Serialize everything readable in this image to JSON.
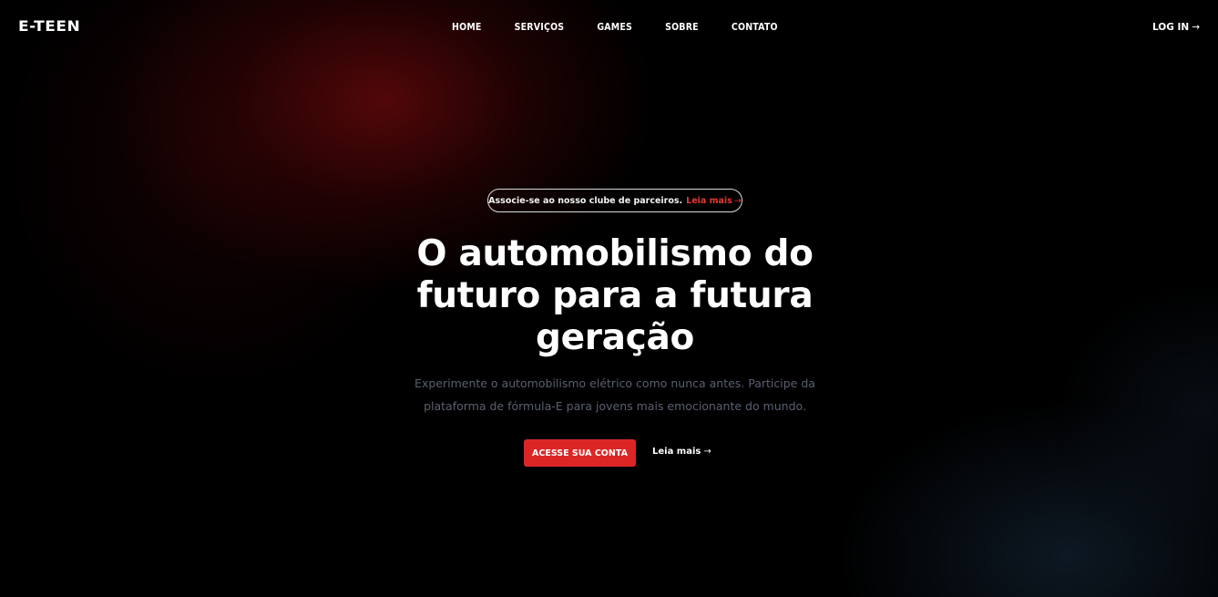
{
  "header": {
    "logo": "E-TEEN",
    "nav": [
      "HOME",
      "SERVIÇOS",
      "GAMES",
      "SOBRE",
      "CONTATO"
    ],
    "login_label": "LOG IN",
    "login_icon": "arrow-right-icon"
  },
  "hero": {
    "announcement": {
      "text": "Associe-se ao nosso clube de parceiros.",
      "link_label": "Leia mais",
      "link_icon": "arrow-right-icon",
      "link_color": "#e53935"
    },
    "title_lines": [
      "O automobilismo do",
      "futuro para a futura",
      "geração"
    ],
    "description_lines": [
      "Experimente o automobilismo elétrico como nunca antes. Participe da",
      "plataforma de fórmula-E para jovens mais emocionante do mundo."
    ],
    "primary_cta": "ACESSE SUA CONTA",
    "secondary_cta": "Leia mais",
    "secondary_icon": "arrow-right-icon"
  },
  "colors": {
    "accent": "#dc2626",
    "background": "#000000",
    "description_text": "#5a6070"
  }
}
